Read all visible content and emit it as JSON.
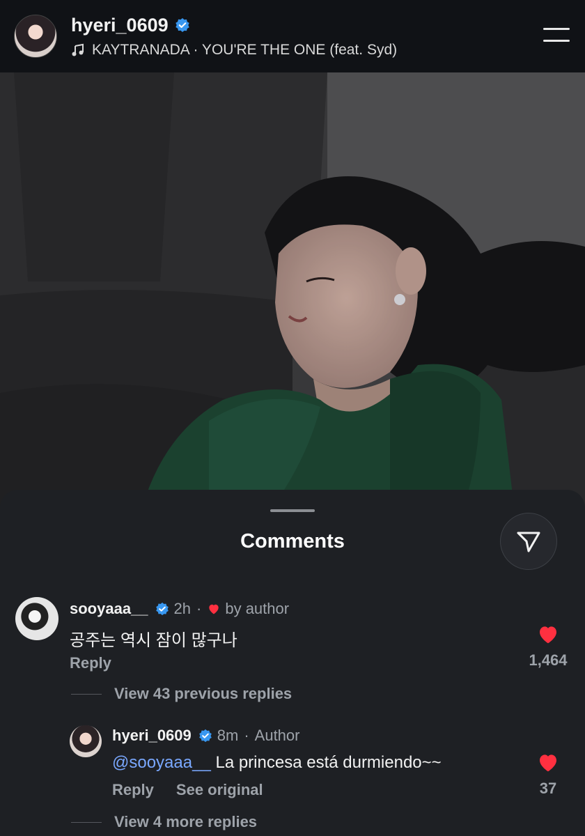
{
  "header": {
    "username": "hyeri_0609",
    "song": "KAYTRANADA · YOU'RE THE ONE (feat. Syd)"
  },
  "sheet": {
    "title": "Comments"
  },
  "comments": [
    {
      "username": "sooyaaa__",
      "time": "2h",
      "separator": "·",
      "liked_by": "by author",
      "text": "공주는 역시 잠이 많구나",
      "reply_label": "Reply",
      "like_count": "1,464",
      "view_replies": "View 43 previous replies"
    },
    {
      "username": "hyeri_0609",
      "time": "8m",
      "separator": "·",
      "badge": "Author",
      "mention": "@sooyaaa__",
      "text": "La princesa está durmiendo~~",
      "reply_label": "Reply",
      "see_original": "See original",
      "like_count": "37",
      "view_replies": "View 4 more replies"
    }
  ],
  "colors": {
    "header_bg": "#101216",
    "sheet_bg": "#1e2024",
    "verified_blue": "#3897f0",
    "like_red": "#ff3040",
    "mention_blue": "#7aa8ff"
  }
}
